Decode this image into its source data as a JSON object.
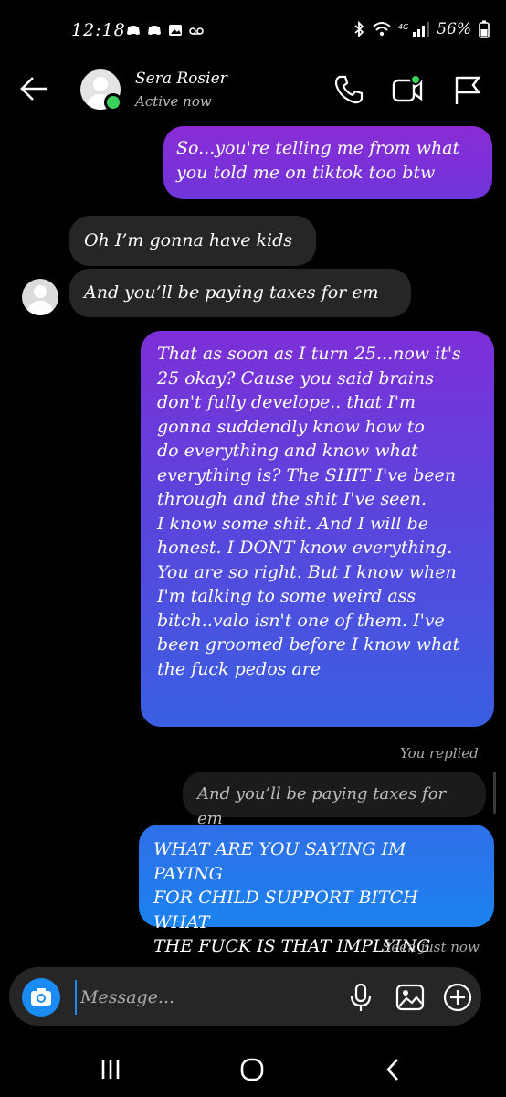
{
  "status_bar": {
    "time": "12:18",
    "battery": "56%"
  },
  "header": {
    "contact_name": "Sera Rosier",
    "activity": "Active now"
  },
  "messages": [
    {
      "sender": "me",
      "text_lines": [
        "So...you're telling me from what",
        "you told me on tiktok too btw"
      ]
    },
    {
      "sender": "them",
      "text_lines": [
        "Oh I’m gonna have kids"
      ]
    },
    {
      "sender": "them",
      "text_lines": [
        "And you’ll be paying taxes for em"
      ]
    },
    {
      "sender": "me",
      "text_lines": [
        "That as soon as I turn 25...now it's",
        "25 okay? Cause you said brains",
        "don't fully develope.. that I'm",
        "gonna suddendly know how to",
        "do everything and know what",
        "everything is? The SHIT I've been",
        "through and the shit I've seen.",
        "I know some shit. And I will be",
        "honest. I DONT know everything.",
        "You are so right. But I know when",
        "I'm talking to some weird ass",
        "bitch..valo isn't one of them. I've",
        "been groomed before I know what",
        "the fuck pedos are"
      ]
    },
    {
      "sender": "me",
      "reply_label": "You replied",
      "quoted": "And you’ll be paying taxes for em",
      "text_lines": [
        "WHAT ARE YOU SAYING IM PAYING",
        "FOR CHILD SUPPORT BITCH WHAT",
        "THE FUCK IS THAT IMPLYING"
      ]
    }
  ],
  "seen_status": "Seen just now",
  "composer": {
    "placeholder": "Message..."
  },
  "icons": {
    "back": "arrow-left-icon",
    "call": "phone-icon",
    "video": "video-camera-icon",
    "flag": "flag-icon",
    "camera": "camera-icon",
    "mic": "microphone-icon",
    "gallery": "image-icon",
    "add": "plus-circle-icon"
  },
  "colors": {
    "accent": "#1b8cf3",
    "active": "#3bd15a",
    "received_bubble": "#262626",
    "grad_top": "#8a2cd6",
    "grad_bottom": "#1f7ae8"
  }
}
